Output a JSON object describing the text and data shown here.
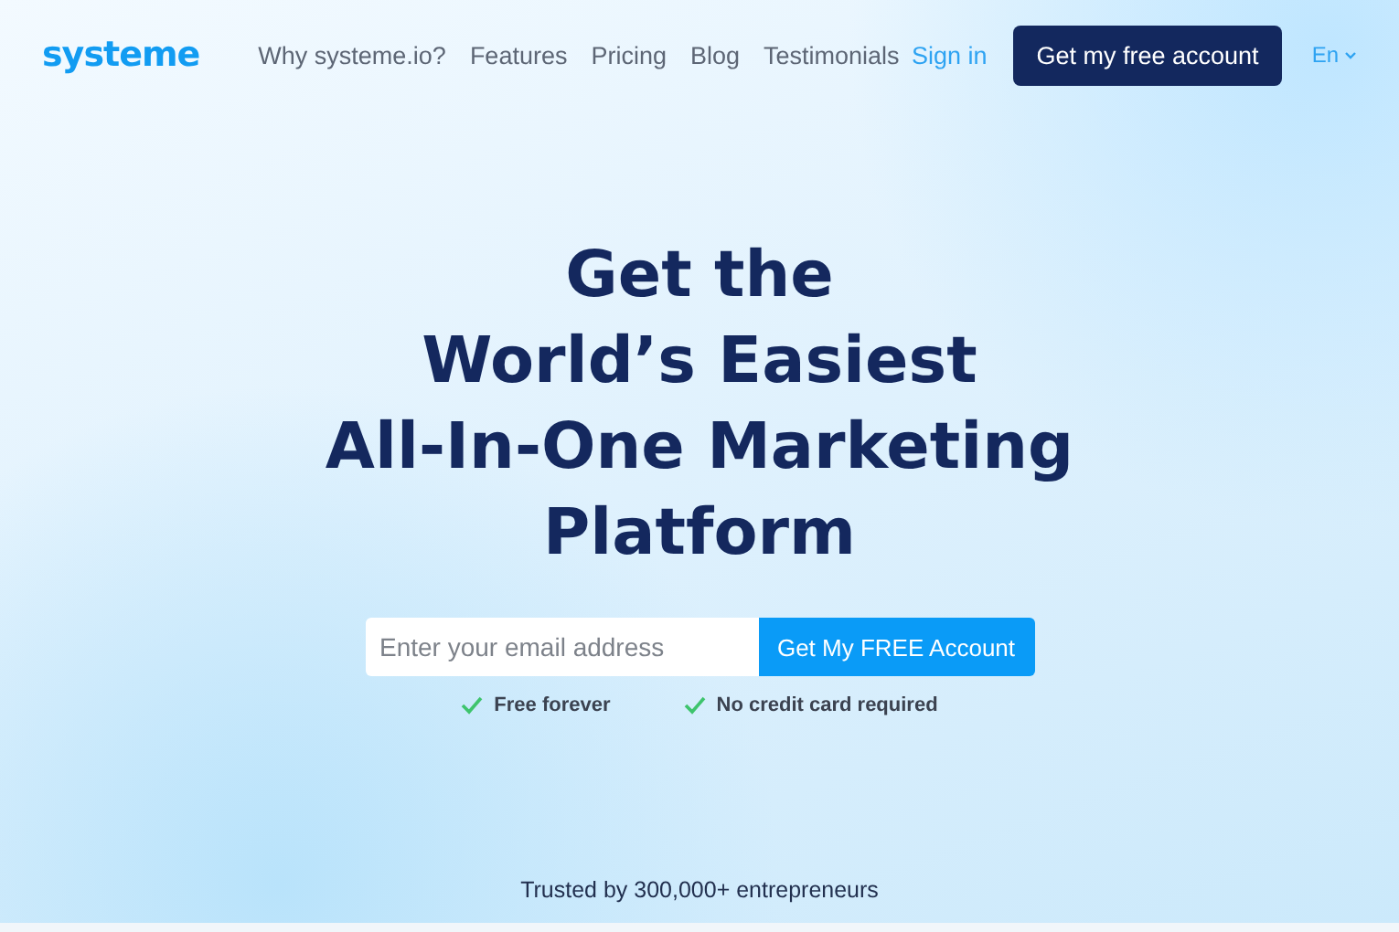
{
  "nav": {
    "logo": "systeme",
    "links": [
      "Why systeme.io?",
      "Features",
      "Pricing",
      "Blog",
      "Testimonials"
    ],
    "sign_in": "Sign in",
    "cta": "Get my free account",
    "language": "En"
  },
  "hero": {
    "headline_lines": [
      "Get the",
      "World’s Easiest",
      "All-In-One Marketing",
      "Platform"
    ],
    "email": {
      "placeholder": "Enter your email address"
    },
    "submit": "Get My FREE Account",
    "perks": [
      "Free forever",
      "No credit card required"
    ]
  },
  "trusted": "Trusted by 300,000+ entrepreneurs"
}
